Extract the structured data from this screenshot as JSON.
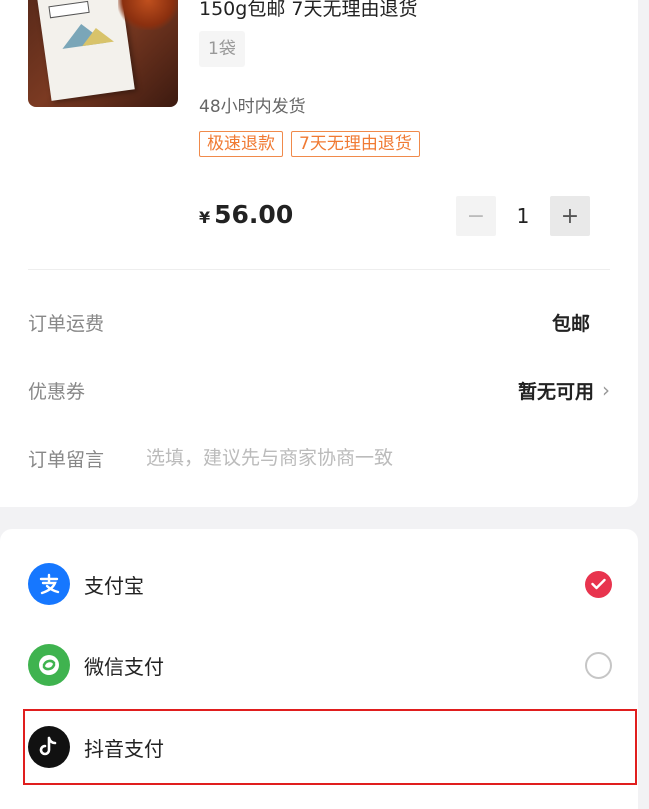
{
  "product": {
    "title": "150g包邮 7天无理由退货",
    "spec": "1袋",
    "shipping": "48小时内发货",
    "tags": [
      "极速退款",
      "7天无理由退货"
    ],
    "currency": "¥",
    "price": "56.00",
    "quantity": "1",
    "minus": "−",
    "plus": "+"
  },
  "order": {
    "freight_label": "订单运费",
    "freight_value": "包邮",
    "coupon_label": "优惠券",
    "coupon_value": "暂无可用",
    "memo_label": "订单留言",
    "memo_placeholder": "选填，建议先与商家协商一致"
  },
  "payment": {
    "methods": [
      {
        "label": "支付宝",
        "icon": "alipay-icon",
        "color": "#1677ff",
        "selected": true
      },
      {
        "label": "微信支付",
        "icon": "wechat-pay-icon",
        "color": "#3fb34f",
        "selected": false
      },
      {
        "label": "抖音支付",
        "icon": "douyin-pay-icon",
        "color": "#111111",
        "selected": false
      }
    ]
  },
  "colors": {
    "accent_orange": "#f07a33",
    "selected_red": "#e8344e",
    "highlight_red": "#e01e1e"
  }
}
